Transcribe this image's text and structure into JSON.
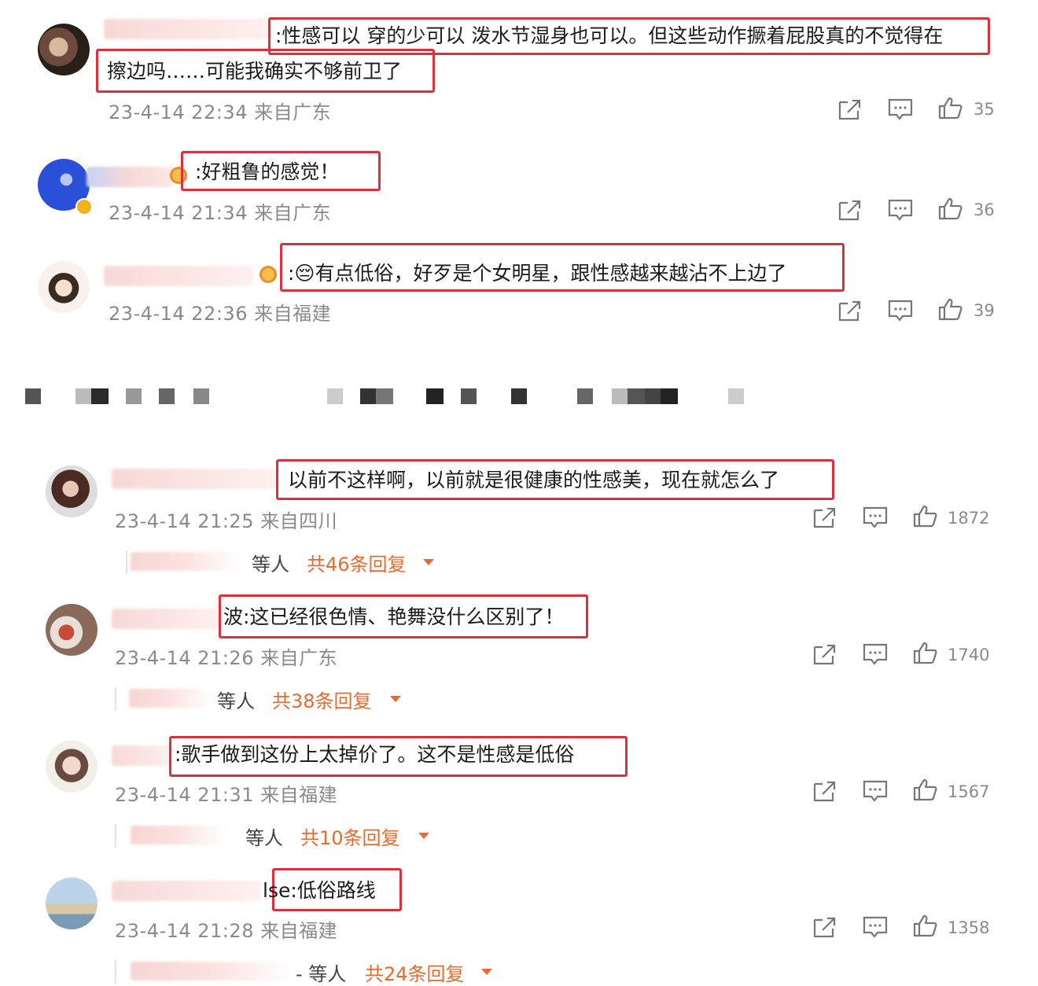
{
  "comments_top": [
    {
      "text_line1": ":性感可以 穿的少可以 泼水节湿身也可以。但这些动作撅着屁股真的不觉得在",
      "text_line2": "擦边吗……可能我确实不够前卫了",
      "time": "23-4-14 22:34 来自广东",
      "likes": "35"
    },
    {
      "text_line1": ":好粗鲁的感觉！",
      "time": "23-4-14 21:34 来自广东",
      "likes": "36"
    },
    {
      "text_line1": ":😔有点低俗，好歹是个女明星，跟性感越来越沾不上边了",
      "time": "23-4-14 22:36 来自福建",
      "likes": "39"
    }
  ],
  "comments_bottom": [
    {
      "text": "以前不这样啊，以前就是很健康的性感美，现在就怎么了",
      "time": "23-4-14 21:25 来自四川",
      "likes": "1872",
      "reply_suffix": "等人",
      "reply_count": "共46条回复"
    },
    {
      "text": "波:这已经很色情、艳舞没什么区别了！",
      "time": "23-4-14 21:26 来自广东",
      "likes": "1740",
      "reply_suffix": "等人",
      "reply_count": "共38条回复"
    },
    {
      "text": ":歌手做到这份上太掉价了。这不是性感是低俗",
      "time": "23-4-14 21:31 来自福建",
      "likes": "1567",
      "reply_suffix": "等人",
      "reply_count": "共10条回复"
    },
    {
      "text": "lse:低俗路线",
      "time": "23-4-14 21:28 来自福建",
      "likes": "1358",
      "reply_suffix": "- 等人",
      "reply_count": "共24条回复"
    }
  ],
  "icons": {
    "share": "share-icon",
    "comment": "comment-icon",
    "like": "like-icon",
    "expand": "chevron-down-icon"
  },
  "colors": {
    "highlight": "#d8323f",
    "reply_accent": "#e86a2c",
    "meta_text": "#8a8a8a"
  }
}
